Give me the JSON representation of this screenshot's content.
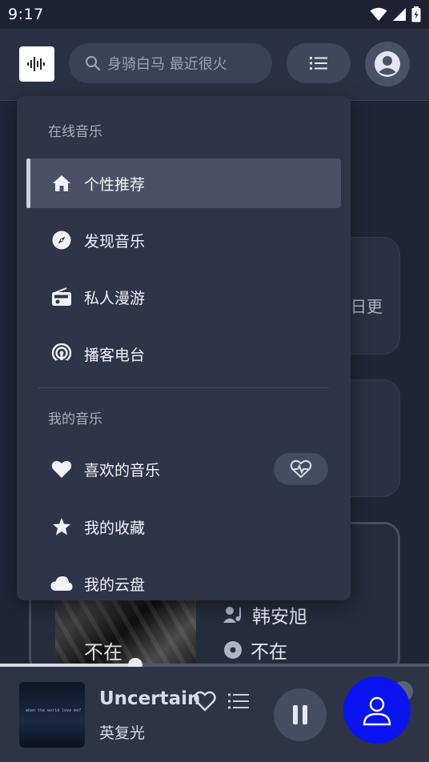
{
  "status_bar": {
    "time": "9:17"
  },
  "search": {
    "placeholder": "身骑白马 最近很火"
  },
  "menu": {
    "section_online": "在线音乐",
    "items_online": [
      {
        "label": "个性推荐",
        "icon": "home-icon",
        "active": true
      },
      {
        "label": "发现音乐",
        "icon": "compass-icon"
      },
      {
        "label": "私人漫游",
        "icon": "radio-icon"
      },
      {
        "label": "播客电台",
        "icon": "podcast-icon"
      }
    ],
    "section_mine": "我的音乐",
    "items_mine": [
      {
        "label": "喜欢的音乐",
        "icon": "heart-icon"
      },
      {
        "label": "我的收藏",
        "icon": "star-icon"
      },
      {
        "label": "我的云盘",
        "icon": "cloud-icon"
      }
    ]
  },
  "background": {
    "card_text_fragment": "日更",
    "album_art_text": "不在",
    "artist": "韩安旭",
    "album": "不在"
  },
  "player": {
    "song_title": "Uncertain",
    "artist": "英复光",
    "cover_caption": "when the world love me?",
    "progress_fraction": 0.315
  },
  "colors": {
    "fab": "#0a14f0",
    "accent": "#c9cee0"
  }
}
